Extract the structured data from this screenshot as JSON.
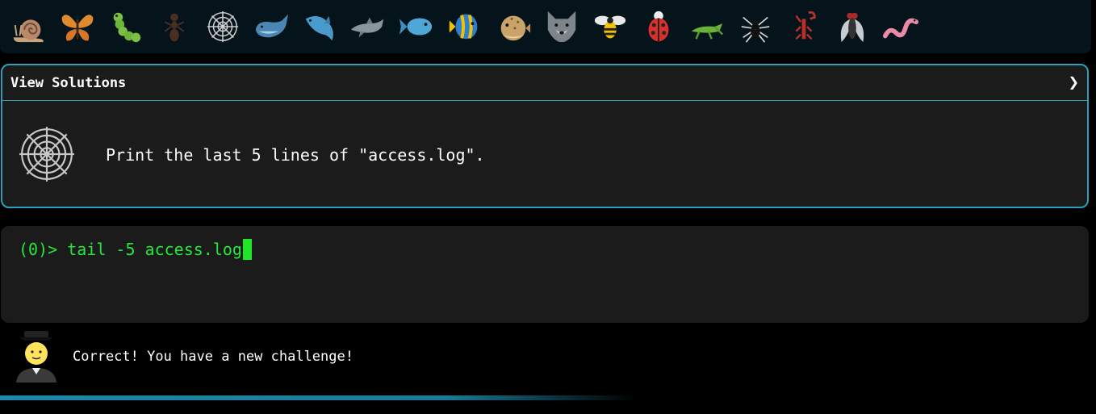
{
  "icon_bar": {
    "icons": [
      "snail-icon",
      "butterfly-icon",
      "caterpillar-icon",
      "ant-icon",
      "spider-web-icon",
      "whale-icon",
      "spouting-dolphin-icon",
      "dolphin-icon",
      "fish-icon",
      "tropical-fish-icon",
      "blowfish-icon",
      "wolf-icon",
      "bee-icon",
      "ladybug-icon",
      "cricket-icon",
      "spider-icon",
      "scorpion-icon",
      "fly-icon",
      "worm-icon"
    ]
  },
  "solutions_panel": {
    "header_label": "View Solutions",
    "chevron": "❯",
    "challenge_icon": "spider-web-icon",
    "challenge_text": "Print the last 5 lines of \"access.log\"."
  },
  "terminal": {
    "prompt": "(0)>",
    "command": "tail -5 access.log"
  },
  "status": {
    "avatar_icon": "student-icon",
    "message": "Correct! You have a new challenge!"
  },
  "progress": {
    "fraction": 0.58
  },
  "colors": {
    "accent": "#2aa0bf",
    "terminal_text": "#22e83a",
    "panel_bg": "#1b1b1b",
    "bar_bg": "#04141a"
  }
}
